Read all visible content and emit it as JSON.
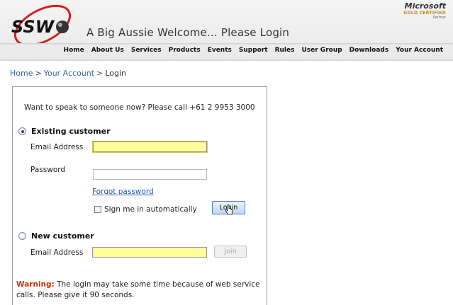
{
  "header": {
    "logo_text": "SSW",
    "tagline": "A Big Aussie Welcome... Please Login",
    "partner_logo": {
      "brand": "Microsoft",
      "certification": "GOLD CERTIFIED",
      "partner": "Partner"
    },
    "nav": [
      "Home",
      "About Us",
      "Services",
      "Products",
      "Events",
      "Support",
      "Rules",
      "User Group",
      "Downloads",
      "Your Account"
    ]
  },
  "breadcrumb": {
    "items": [
      "Home",
      "Your Account"
    ],
    "current": "Login",
    "separator": ">"
  },
  "login": {
    "call_text": "Want to speak to someone now? Please call +61 2 9953 3000",
    "existing": {
      "label": "Existing customer",
      "selected": true,
      "email_label": "Email Address",
      "email_value": "",
      "password_label": "Password",
      "password_value": "",
      "forgot_link": "Forgot password",
      "remember_label": "Sign me in automatically",
      "remember_checked": false,
      "login_button": "Login"
    },
    "new_customer": {
      "label": "New customer",
      "selected": false,
      "email_label": "Email Address",
      "email_value": "",
      "join_button": "Join"
    },
    "warning": {
      "label": "Warning:",
      "text": "The login may take some time because of web service calls. Please give it 90 seconds."
    }
  },
  "colors": {
    "link": "#3366aa",
    "warning": "#cc3300",
    "field_highlight": "#ffff99",
    "logo_red": "#d62020"
  }
}
